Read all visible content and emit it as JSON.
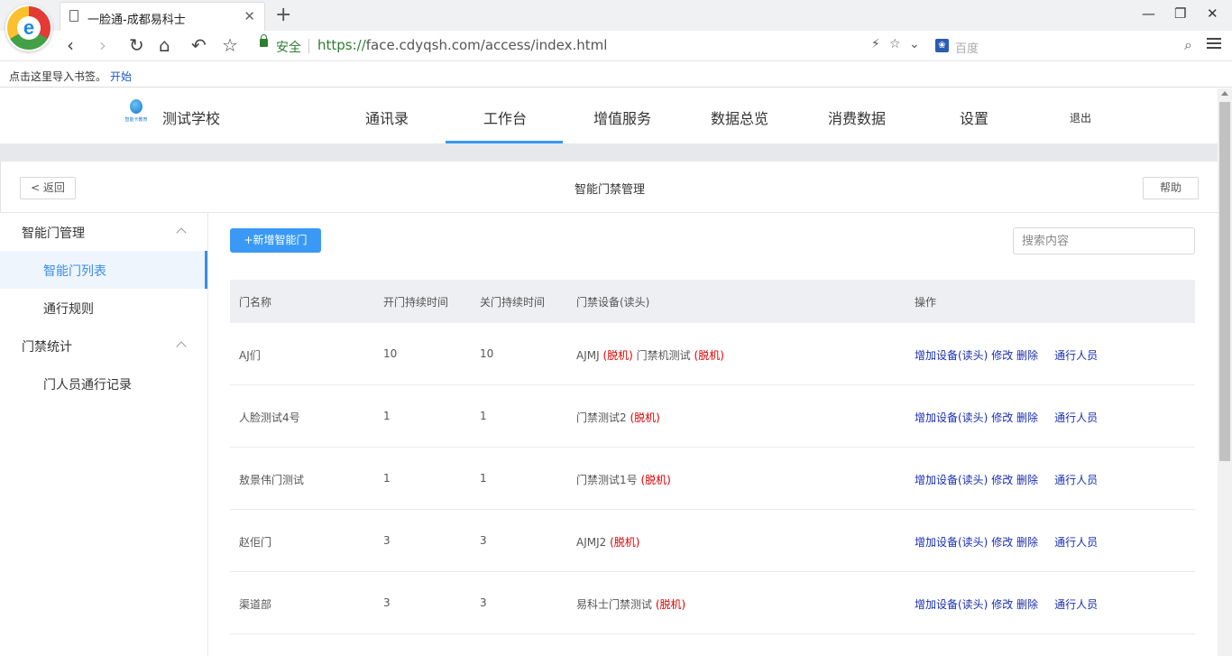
{
  "browser": {
    "tab_title": "一脸通-成都易科士",
    "logo_letter": "e",
    "secure_label": "安全",
    "url_proto": "https://",
    "url_rest": "face.cdyqsh.com/access/index.html",
    "search_engine_placeholder": "百度",
    "bookmark_hint": "点击这里导入书签。",
    "bookmark_start": "开始"
  },
  "topnav": {
    "school": "测试学校",
    "menus": [
      "通讯录",
      "工作台",
      "增值服务",
      "数据总览",
      "消费数据",
      "设置"
    ],
    "active_menu": "工作台",
    "logout": "退出",
    "logo_caption": "智能卡教育"
  },
  "subheader": {
    "back": "< 返回",
    "title": "智能门禁管理",
    "help": "帮助"
  },
  "sidebar": {
    "group1": "智能门管理",
    "item_list": "智能门列表",
    "item_rules": "通行规则",
    "group2": "门禁统计",
    "item_records": "门人员通行记录"
  },
  "main": {
    "add_button": "+新增智能门",
    "search_placeholder": "搜索内容"
  },
  "table": {
    "headers": [
      "门名称",
      "开门持续时间",
      "关门持续时间",
      "门禁设备(读头)",
      "操作"
    ],
    "offline_label": "(脱机)",
    "ops": {
      "add_device": "增加设备(读头)",
      "edit": "修改",
      "delete": "删除",
      "people": "通行人员"
    },
    "rows": [
      {
        "name": "AJ们",
        "open": "10",
        "close": "10",
        "devices": [
          "AJMJ",
          "门禁机测试"
        ]
      },
      {
        "name": "人脸测试4号",
        "open": "1",
        "close": "1",
        "devices": [
          "门禁测试2"
        ]
      },
      {
        "name": "敖景伟门测试",
        "open": "1",
        "close": "1",
        "devices": [
          "门禁测试1号"
        ]
      },
      {
        "name": "赵佢门",
        "open": "3",
        "close": "3",
        "devices": [
          "AJMJ2"
        ]
      },
      {
        "name": "渠道部",
        "open": "3",
        "close": "3",
        "devices": [
          "易科士门禁测试"
        ]
      }
    ]
  },
  "colors": {
    "accent": "#3a99f5",
    "offline": "#dd0000",
    "link": "#1a2fb0",
    "secure": "#2e7d32"
  }
}
